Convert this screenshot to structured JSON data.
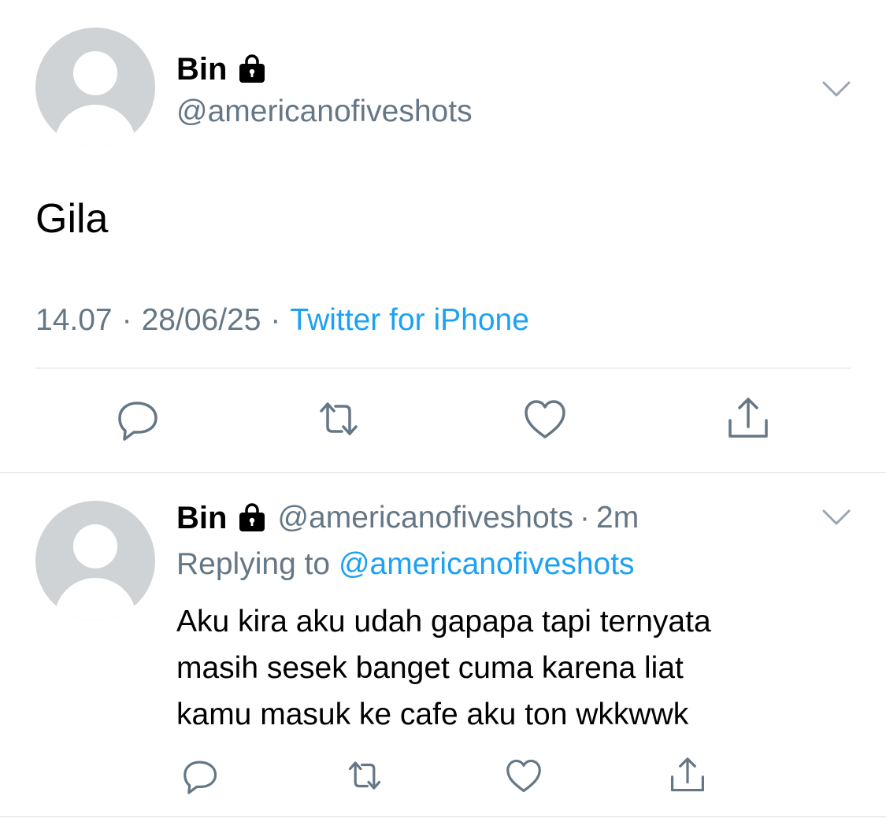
{
  "main_tweet": {
    "display_name": "Bin",
    "handle": "@americanofiveshots",
    "text": "Gila",
    "time": "14.07",
    "date": "28/06/25",
    "separator": "·",
    "source": "Twitter for iPhone",
    "icons": [
      "lock-icon",
      "chevron-down-icon",
      "reply-icon",
      "retweet-icon",
      "like-icon",
      "share-icon"
    ]
  },
  "reply_tweet": {
    "display_name": "Bin",
    "handle": "@americanofiveshots",
    "separator": "·",
    "time_ago": "2m",
    "replying_label": "Replying to",
    "replying_to": "@americanofiveshots",
    "text_lines": [
      "Aku kira aku udah gapapa tapi ternyata",
      "masih sesek banget cuma karena liat",
      "kamu masuk ke cafe aku ton wkkwwk"
    ]
  },
  "colors": {
    "text_primary": "#000000",
    "text_secondary": "#657786",
    "link": "#1da1f2",
    "icon": "#657786",
    "divider": "#d9dee2",
    "avatar_bg": "#cfd3d6"
  }
}
